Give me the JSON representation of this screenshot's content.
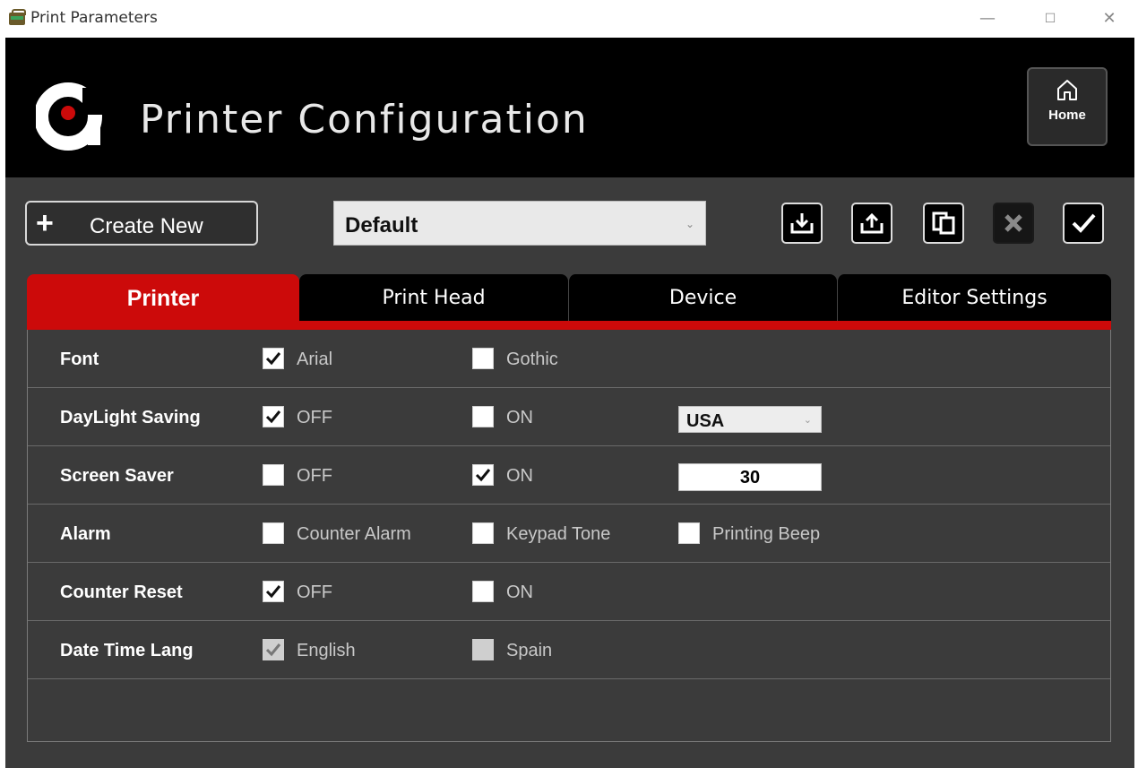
{
  "window": {
    "title": "Print Parameters",
    "minimize": "—",
    "maximize": "☐",
    "close": "✕"
  },
  "header": {
    "title": "Printer Configuration",
    "home_label": "Home"
  },
  "toolbar": {
    "create_label": "Create New",
    "profile_value": "Default",
    "icons": [
      "import-icon",
      "export-icon",
      "copy-icon",
      "delete-icon",
      "apply-icon"
    ]
  },
  "tabs": [
    {
      "label": "Printer",
      "active": true
    },
    {
      "label": "Print Head",
      "active": false
    },
    {
      "label": "Device",
      "active": false
    },
    {
      "label": "Editor Settings",
      "active": false
    }
  ],
  "settings": {
    "font": {
      "label": "Font",
      "opt1": "Arial",
      "opt1_checked": true,
      "opt2": "Gothic",
      "opt2_checked": false
    },
    "daylight": {
      "label": "DayLight Saving",
      "opt1": "OFF",
      "opt1_checked": true,
      "opt2": "ON",
      "opt2_checked": false,
      "country": "USA"
    },
    "screensaver": {
      "label": "Screen Saver",
      "opt1": "OFF",
      "opt1_checked": false,
      "opt2": "ON",
      "opt2_checked": true,
      "value": "30"
    },
    "alarm": {
      "label": "Alarm",
      "opt1": "Counter Alarm",
      "opt2": "Keypad Tone",
      "opt3": "Printing Beep"
    },
    "counter_reset": {
      "label": "Counter Reset",
      "opt1": "OFF",
      "opt1_checked": true,
      "opt2": "ON",
      "opt2_checked": false
    },
    "date_lang": {
      "label": "Date Time Lang",
      "opt1": "English",
      "opt1_checked": true,
      "opt2": "Spain",
      "opt2_checked": false
    }
  },
  "colors": {
    "accent_red": "#cc0a0a",
    "panel_bg": "#3b3b3b",
    "header_bg": "#000000"
  }
}
